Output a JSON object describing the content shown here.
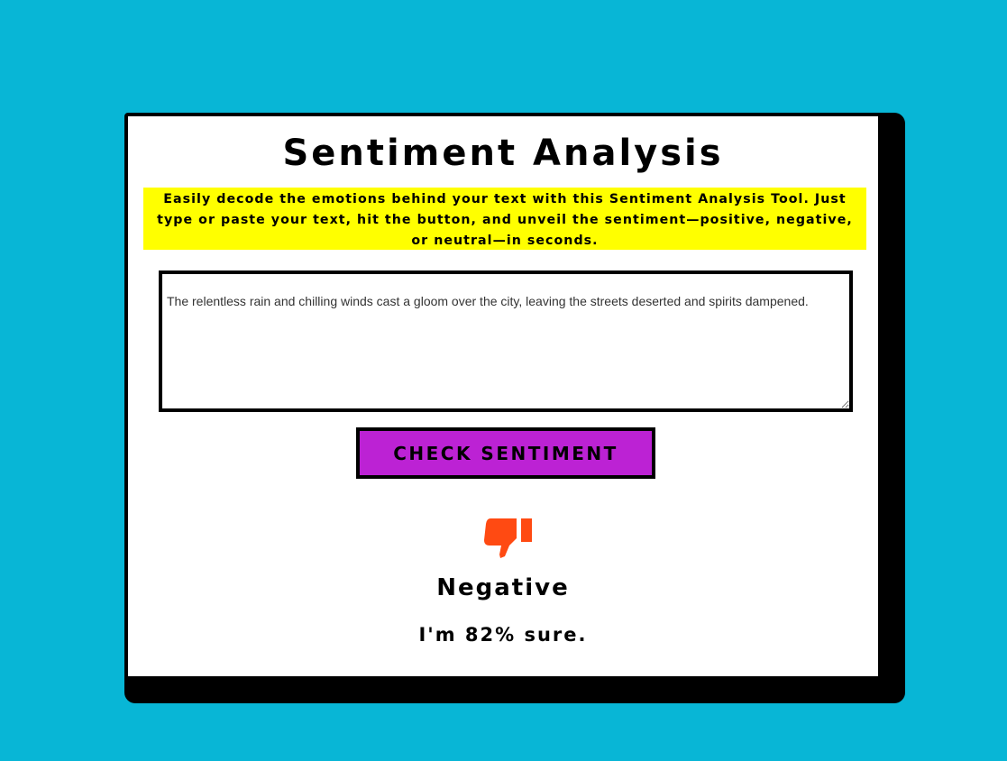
{
  "app": {
    "title": "Sentiment Analysis",
    "description": "Easily decode the emotions behind your text with this Sentiment Analysis Tool. Just type or paste your text, hit the button, and unveil the sentiment—positive, negative, or neutral—in seconds."
  },
  "input": {
    "value": "The relentless rain and chilling winds cast a gloom over the city, leaving the streets deserted and spirits dampened."
  },
  "button": {
    "label": "CHECK SENTIMENT"
  },
  "result": {
    "icon": "thumbs-down-icon",
    "icon_color": "#ff4a12",
    "label": "Negative",
    "confidence_text": "I'm 82% sure."
  },
  "colors": {
    "background": "#08b6d6",
    "highlight": "#ffff00",
    "button": "#bc22d4",
    "accent": "#ff4a12"
  }
}
